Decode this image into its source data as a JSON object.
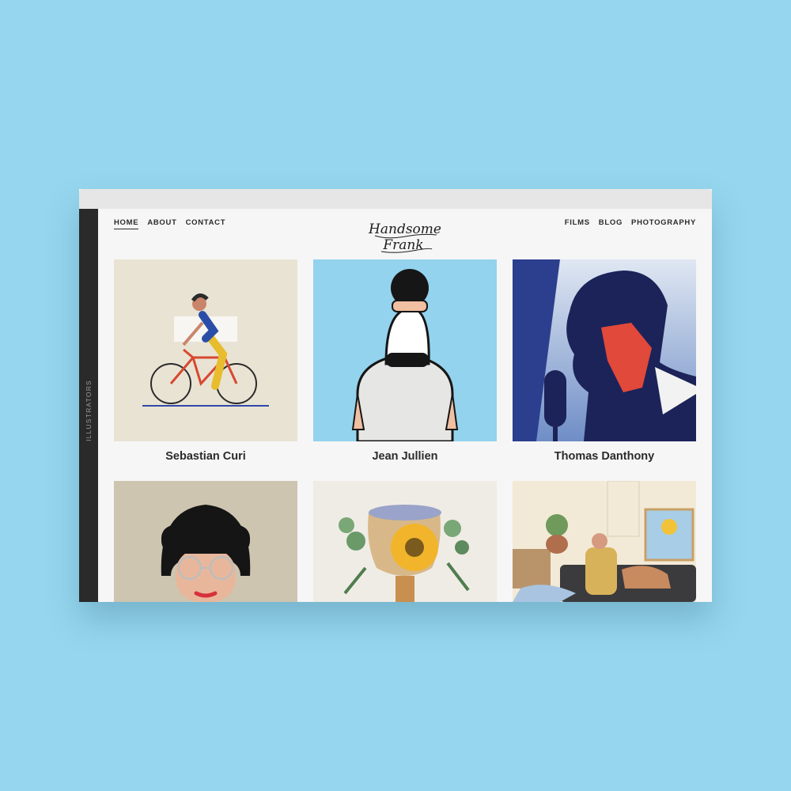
{
  "sidebar": {
    "label": "ILLUSTRATORS"
  },
  "nav": {
    "left": [
      {
        "label": "HOME",
        "active": true
      },
      {
        "label": "ABOUT"
      },
      {
        "label": "CONTACT"
      }
    ],
    "right": [
      {
        "label": "FILMS"
      },
      {
        "label": "BLOG"
      },
      {
        "label": "PHOTOGRAPHY"
      }
    ]
  },
  "logo": {
    "line1": "Handsome",
    "line2": "Frank"
  },
  "illustrators": [
    {
      "name": "Sebastian Curi",
      "bg": "#e9e3d4"
    },
    {
      "name": "Jean Jullien",
      "bg": "#93d3ee"
    },
    {
      "name": "Thomas Danthony",
      "bg": "#3a5fa8"
    },
    {
      "name": "",
      "bg": "#cdc5b0"
    },
    {
      "name": "",
      "bg": "#efece5"
    },
    {
      "name": "",
      "bg": "#f2ead7"
    }
  ],
  "colors": {
    "page_bg": "#96d7ef",
    "site_bg": "#f6f6f6",
    "rail": "#2a2a2a",
    "text": "#2b2b2b"
  }
}
